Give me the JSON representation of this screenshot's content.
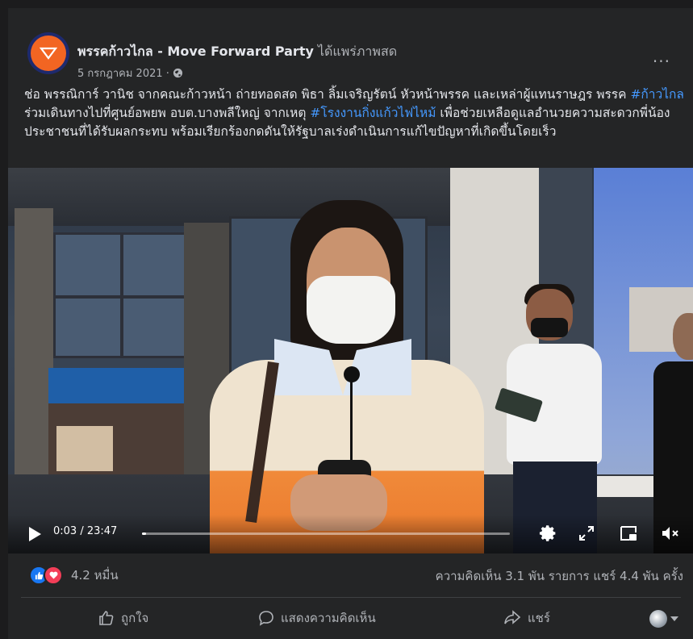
{
  "post": {
    "page_name": "พรรคก้าวไกล - Move Forward Party",
    "status_text": " ได้แพร่ภาพสด",
    "date": "5 กรกฎาคม 2021 ·",
    "privacy_icon": "globe-icon",
    "more_label": "...",
    "text_1": "ช่อ พรรณิการ์ วานิช จากคณะก้าวหน้า ถ่ายทอดสด พิธา ลิ้มเจริญรัตน์ หัวหน้าพรรค และเหล่าผู้แทนราษฎร พรรค ",
    "hashtag_1": "#ก้าวไกล",
    "text_2": " ร่วมเดินทางไปที่ศูนย์อพยพ อบต.บางพลีใหญ่ จากเหตุ ",
    "hashtag_2": "#โรงงานกิ่งแก้วไฟไหม้",
    "text_3": " เพื่อช่วยเหลือดูแลอำนวยความสะดวกพี่น้องประชาชนที่ได้รับผลกระทบ พร้อมเรียกร้องกดดันให้รัฐบาลเร่งดำเนินการแก้ไขปัญหาที่เกิดขึ้นโดยเร็ว"
  },
  "video": {
    "time_display": "0:03 / 23:47",
    "progress_fraction": 0.002
  },
  "stats": {
    "reaction_count": "4.2 หมื่น",
    "comments_shares": "ความคิดเห็น 3.1 พัน รายการ  แชร์ 4.4 พัน ครั้ง"
  },
  "actions": {
    "like": "ถูกใจ",
    "comment": "แสดงความคิดเห็น",
    "share": "แชร์"
  },
  "colors": {
    "background": "#242526",
    "link": "#4599ff",
    "brand_orange": "#f26522",
    "like_blue": "#1877f2",
    "love_red": "#f33e58"
  }
}
